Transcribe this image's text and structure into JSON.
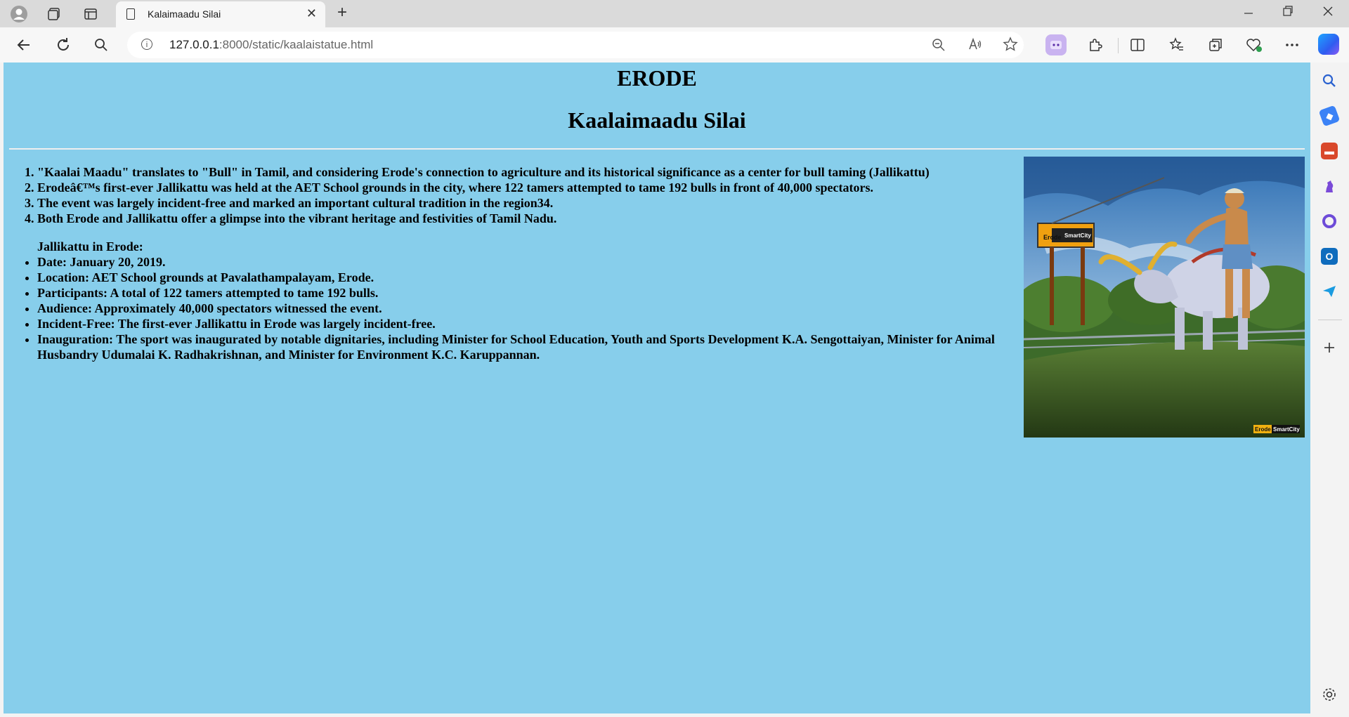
{
  "browser": {
    "tab_title": "Kalaimaadu Silai",
    "url_host": "127.0.0.1",
    "url_rest": ":8000/static/kaalaistatue.html",
    "tab_close": "✕",
    "new_tab": "+"
  },
  "page": {
    "heading": "ERODE",
    "subheading": "Kaalaimaadu Silai",
    "facts": [
      "\"Kaalai Maadu\" translates to \"Bull\" in Tamil, and considering Erode's connection to agriculture and its historical significance as a center for bull taming (Jallikattu)",
      "Erodeâ€™s first-ever Jallikattu was held at the AET School grounds in the city, where 122 tamers attempted to tame 192 bulls in front of 40,000 spectators.",
      "The event was largely incident-free and marked an important cultural tradition in the region34.",
      "Both Erode and Jallikattu offer a glimpse into the vibrant heritage and festivities of Tamil Nadu."
    ],
    "details_heading": "Jallikattu in Erode:",
    "details": [
      "Date: January 20, 2019.",
      "Location: AET School grounds at Pavalathampalayam, Erode.",
      "Participants: A total of 122 tamers attempted to tame 192 bulls.",
      "Audience: Approximately 40,000 spectators witnessed the event.",
      "Incident-Free: The first-ever Jallikattu in Erode was largely incident-free.",
      "Inauguration: The sport was inaugurated by notable dignitaries, including Minister for School Education, Youth and Sports Development K.A. Sengottaiyan, Minister for Animal Husbandry Udumalai K. Radhakrishnan, and Minister for Environment K.C. Karuppannan."
    ],
    "photo_sign_text": "Erode SmartCity",
    "photo_watermark": "Erode SmartCity"
  },
  "colors": {
    "page_background": "#87ceeb"
  }
}
